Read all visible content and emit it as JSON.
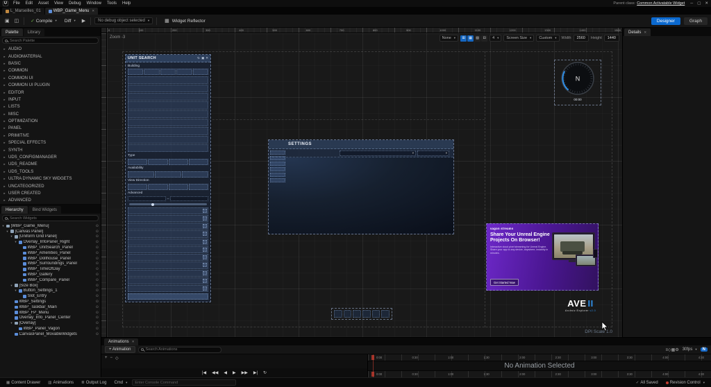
{
  "window": {
    "menu_items": [
      "File",
      "Edit",
      "Asset",
      "View",
      "Debug",
      "Window",
      "Tools",
      "Help"
    ],
    "parent_class_label": "Parent class:",
    "parent_class_value": "Common Activatable Widget"
  },
  "asset_tabs": {
    "level_tab": "L_Marseilles_01",
    "widget_tab": "WBP_Game_Menu"
  },
  "toolbar": {
    "compile_label": "Compile",
    "diff_label": "Diff",
    "debug_object": "No debug object selected",
    "widget_reflector": "Widget Reflector",
    "designer_label": "Designer",
    "graph_label": "Graph"
  },
  "palette": {
    "tabs": [
      "Palette",
      "Library"
    ],
    "search_placeholder": "Search Palette",
    "categories": [
      "AUDIO",
      "AUDIOMATERIAL",
      "BASIC",
      "COMMON",
      "COMMON UI",
      "COMMON UI PLUGIN",
      "EDITOR",
      "INPUT",
      "LISTS",
      "MISC",
      "OPTIMIZATION",
      "PANEL",
      "PRIMITIVE",
      "SPECIAL EFFECTS",
      "SYNTH",
      "UDS_CONFIGMANAGER",
      "UDS_README",
      "UDS_TOOLS",
      "ULTRA DYNAMIC SKY WIDGETS",
      "UNCATEGORIZED",
      "USER CREATED",
      "ADVANCED"
    ]
  },
  "hierarchy": {
    "tabs": [
      "Hierarchy",
      "Bind Widgets"
    ],
    "search_placeholder": "Search Widgets",
    "items": [
      {
        "label": "[WBP_Game_Menu]",
        "indent": 0,
        "children": true
      },
      {
        "label": "[Canvas Panel]",
        "indent": 1,
        "children": true
      },
      {
        "label": "[Uniform Grid Panel]",
        "indent": 2,
        "children": true
      },
      {
        "label": "Overlay_InfoPanel_Right",
        "indent": 3,
        "children": true
      },
      {
        "label": "WBP_UnitSearch_Panel",
        "indent": 4
      },
      {
        "label": "WBP_Amenities_Panel",
        "indent": 4
      },
      {
        "label": "WBP_Dollhouse_Panel",
        "indent": 4
      },
      {
        "label": "WBP_Surroundings_Panel",
        "indent": 4
      },
      {
        "label": "WBP_TimeOfDay",
        "indent": 4
      },
      {
        "label": "WBP_Gallery",
        "indent": 4
      },
      {
        "label": "WBP_Compare_Panel",
        "indent": 4
      },
      {
        "label": "[Size Box]",
        "indent": 2,
        "children": true
      },
      {
        "label": "Button_Settings_1",
        "indent": 3,
        "children": true
      },
      {
        "label": "Slot_Entry",
        "indent": 4
      },
      {
        "label": "WBP_Settings",
        "indent": 2
      },
      {
        "label": "WBP_Taskbar_Main",
        "indent": 2
      },
      {
        "label": "WBP_FP_Menu",
        "indent": 2
      },
      {
        "label": "Overlay_Info_Panel_Center",
        "indent": 2
      },
      {
        "label": "[Overlay]",
        "indent": 2,
        "children": true
      },
      {
        "label": "WBP_Panel_Vagon",
        "indent": 3
      },
      {
        "label": "CanvasPanel_MovableWidgets",
        "indent": 2
      }
    ]
  },
  "details": {
    "tab": "Details"
  },
  "canvas": {
    "zoom_label": "Zoom -3",
    "dpi_label": "DPI Scale 1.0",
    "view_toolbar": {
      "none": "None",
      "snap": "4",
      "screen_size": "Screen Size",
      "fill_mode": "Custom",
      "width_label": "Width",
      "width_value": "2560",
      "height_label": "Height",
      "height_value": "1440"
    },
    "ruler_top": [
      "0",
      "100",
      "200",
      "300",
      "400",
      "500",
      "600",
      "700",
      "800",
      "900",
      "1000",
      "1100",
      "1200",
      "1300",
      "1400",
      "1500"
    ],
    "unit_search": {
      "title": "UNIT SEARCH",
      "labels": {
        "building": "Building",
        "type": "Type",
        "availability": "Availability",
        "view_direction": "View Direction",
        "advanced": "Advanced"
      }
    },
    "settings": {
      "title": "SETTINGS"
    },
    "compass": {
      "north": "N",
      "time": "00:00"
    },
    "promo": {
      "brand": "vagon streams",
      "heading": "Share Your Unreal Engine Projects On Browser!",
      "body": "Interactive cloud pixel streaming for Unreal Engine. Share your app to any device, anywhere, instantly in minutes.",
      "cta": "Get Started Now"
    },
    "ave_logo": {
      "main": "AVE",
      "suffix": "II",
      "sub": "Archviz Explorer",
      "version": "v2.0"
    }
  },
  "animations": {
    "tab": "Animations",
    "add_button": "+ Animation",
    "search_placeholder": "Search Animations",
    "toolbar_icons": [
      "≡",
      "◇",
      "▦",
      "⚙"
    ],
    "fps": "30fps",
    "n_badge": "N",
    "no_selection": "No Animation Selected",
    "key_tools": [
      "+",
      "−",
      "◇"
    ],
    "transport": [
      "|◀",
      "◀◀",
      "◀",
      "▶",
      "▶▶",
      "▶|",
      "↻"
    ],
    "timeline_top": [
      "0:00",
      "0:30",
      "1:00",
      "1:30",
      "2:00",
      "2:30",
      "3:00",
      "3:30",
      "4:00",
      "4:30"
    ],
    "timeline_bottom": [
      "0:00",
      "0:30",
      "1:00",
      "1:30",
      "2:00",
      "2:30",
      "3:00",
      "3:30",
      "4:00",
      "4:30"
    ]
  },
  "statusbar": {
    "content_drawer": "Content Drawer",
    "animations": "Animations",
    "output_log": "Output Log",
    "cmd": "Cmd",
    "console_hint": "Enter Console Command",
    "all_saved": "All Saved",
    "revision_control": "Revision Control"
  },
  "colors": {
    "accent_blue": "#0b69cf",
    "compile_green": "#77c04b",
    "promo_purple": "#6d28c9",
    "playhead_red": "#a03228"
  }
}
